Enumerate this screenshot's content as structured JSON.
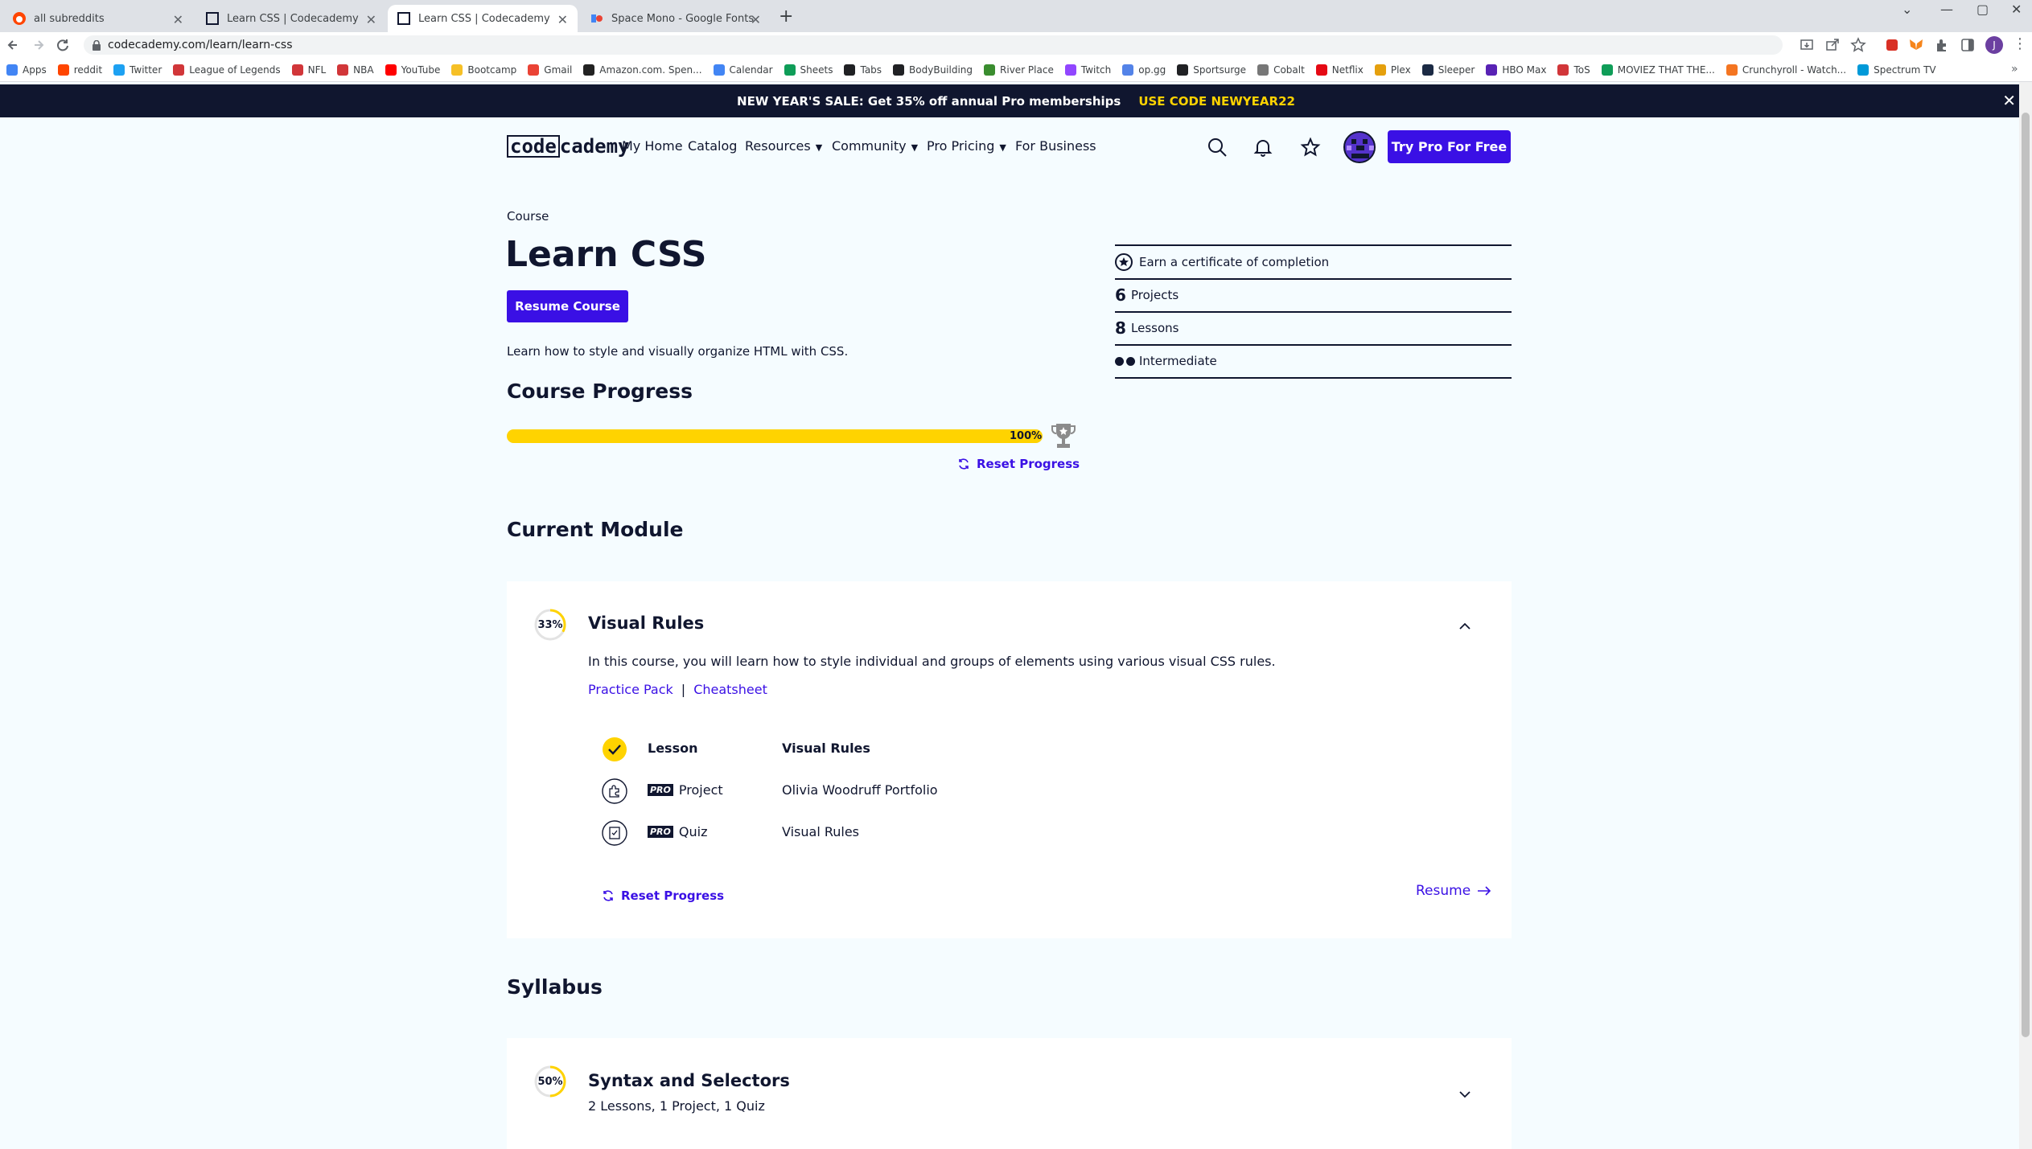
{
  "browser": {
    "tabs": [
      {
        "title": "all subreddits",
        "active": false,
        "favicon_color": "#ff4500"
      },
      {
        "title": "Learn CSS | Codecademy",
        "active": false,
        "favicon_color": "#10162f"
      },
      {
        "title": "Learn CSS | Codecademy",
        "active": true,
        "favicon_color": "#10162f"
      },
      {
        "title": "Space Mono - Google Fonts",
        "active": false,
        "favicon_color": "#4285f4"
      }
    ],
    "url": "codecademy.com/learn/learn-css",
    "bookmarks": [
      {
        "label": "Apps",
        "color": "#4285f4"
      },
      {
        "label": "reddit",
        "color": "#ff4500"
      },
      {
        "label": "Twitter",
        "color": "#1da1f2"
      },
      {
        "label": "League of Legends",
        "color": "#d13639"
      },
      {
        "label": "NFL",
        "color": "#d13639"
      },
      {
        "label": "NBA",
        "color": "#d13639"
      },
      {
        "label": "YouTube",
        "color": "#ff0000"
      },
      {
        "label": "Bootcamp",
        "color": "#f6c026"
      },
      {
        "label": "Gmail",
        "color": "#ea4335"
      },
      {
        "label": "Amazon.com. Spen...",
        "color": "#222222"
      },
      {
        "label": "Calendar",
        "color": "#4285f4"
      },
      {
        "label": "Sheets",
        "color": "#0f9d58"
      },
      {
        "label": "Tabs",
        "color": "#202124"
      },
      {
        "label": "BodyBuilding",
        "color": "#202124"
      },
      {
        "label": "River Place",
        "color": "#3a8d2f"
      },
      {
        "label": "Twitch",
        "color": "#9146ff"
      },
      {
        "label": "op.gg",
        "color": "#5383e8"
      },
      {
        "label": "Sportsurge",
        "color": "#202124"
      },
      {
        "label": "Cobalt",
        "color": "#777777"
      },
      {
        "label": "Netflix",
        "color": "#e50914"
      },
      {
        "label": "Plex",
        "color": "#e5a00d"
      },
      {
        "label": "Sleeper",
        "color": "#1b2a44"
      },
      {
        "label": "HBO Max",
        "color": "#5822b4"
      },
      {
        "label": "ToS",
        "color": "#d13639"
      },
      {
        "label": "MOVIEZ THAT THE...",
        "color": "#0f9d58"
      },
      {
        "label": "Crunchyroll - Watch...",
        "color": "#f47521"
      },
      {
        "label": "Spectrum TV",
        "color": "#0099d8"
      }
    ]
  },
  "promo": {
    "text": "NEW YEAR'S SALE: Get 35% off annual Pro memberships",
    "code": "USE CODE NEWYEAR22"
  },
  "header": {
    "logo_left": "code",
    "logo_right": "cademy",
    "nav": {
      "my_home": "My Home",
      "catalog": "Catalog",
      "resources": "Resources",
      "community": "Community",
      "pro_pricing": "Pro Pricing",
      "for_business": "For Business"
    },
    "try_pro": "Try Pro For Free",
    "avatar_initial": "J"
  },
  "course": {
    "eyebrow": "Course",
    "title": "Learn CSS",
    "resume_label": "Resume Course",
    "description": "Learn how to style and visually organize HTML with CSS.",
    "progress_heading": "Course Progress",
    "progress_percent": 100,
    "progress_label": "100%",
    "reset_label": "Reset Progress",
    "stats": {
      "certificate": "Earn a certificate of completion",
      "projects_count": "6",
      "projects_label": "Projects",
      "lessons_count": "8",
      "lessons_label": "Lessons",
      "level": "Intermediate"
    }
  },
  "current_module": {
    "heading": "Current Module",
    "percent": 33,
    "percent_label": "33%",
    "title": "Visual Rules",
    "description": "In this course, you will learn how to style individual and groups of elements using various visual CSS rules.",
    "links": {
      "practice": "Practice Pack",
      "separator": "|",
      "cheatsheet": "Cheatsheet"
    },
    "items": [
      {
        "type": "Lesson",
        "name": "Visual Rules",
        "pro": false,
        "done": true
      },
      {
        "type": "Project",
        "name": "Olivia Woodruff Portfolio",
        "pro": true,
        "done": false
      },
      {
        "type": "Quiz",
        "name": "Visual Rules",
        "pro": true,
        "done": false
      }
    ],
    "pro_tag": "PRO",
    "reset_label": "Reset Progress",
    "resume_label": "Resume"
  },
  "syllabus": {
    "heading": "Syllabus",
    "modules": [
      {
        "percent": 50,
        "percent_label": "50%",
        "title": "Syntax and Selectors",
        "summary": "2 Lessons, 1 Project, 1 Quiz"
      }
    ]
  },
  "colors": {
    "brand_blue": "#3a10e5",
    "navy": "#10162f",
    "yellow": "#ffd300",
    "page_bg": "#f5fcff"
  }
}
